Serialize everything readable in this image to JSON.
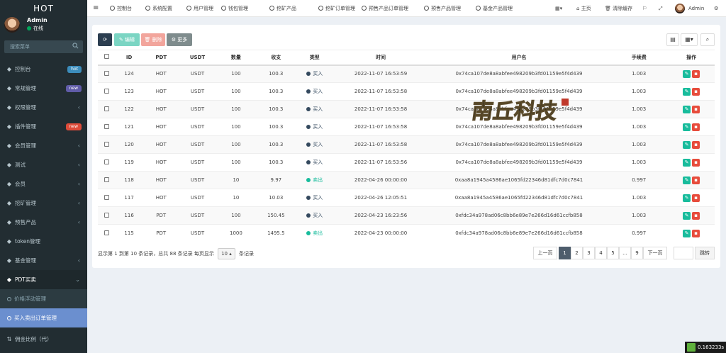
{
  "sidebar": {
    "logo": "HOT",
    "user": {
      "name": "Admin",
      "status": "在线"
    },
    "search_placeholder": "搜索菜单",
    "items": [
      {
        "icon": "dashboard-icon",
        "label": "控制台",
        "badge": "hot"
      },
      {
        "icon": "settings-icon",
        "label": "常规管理",
        "badge": "new"
      },
      {
        "icon": "group-icon",
        "label": "权限管理",
        "arrow": "‹"
      },
      {
        "icon": "plugin-icon",
        "label": "插件管理",
        "badge": "new"
      },
      {
        "icon": "user-group-icon",
        "label": "会员管理",
        "arrow": "‹"
      },
      {
        "icon": "file-icon",
        "label": "测试",
        "arrow": "‹"
      },
      {
        "icon": "user-icon",
        "label": "会员",
        "arrow": "‹"
      },
      {
        "icon": "mining-icon",
        "label": "挖矿管理",
        "arrow": "‹"
      },
      {
        "icon": "presale-icon",
        "label": "预售产品",
        "arrow": "‹"
      },
      {
        "icon": "token-icon",
        "label": "token管理"
      },
      {
        "icon": "fund-icon",
        "label": "基金管理",
        "arrow": "‹"
      },
      {
        "icon": "pdt-trade-icon",
        "label": "PDT买卖",
        "arrow": "⌄"
      }
    ],
    "sub_items": [
      {
        "label": "价格浮动管理"
      },
      {
        "label": "买入卖出订单管理"
      }
    ],
    "bottom_item": {
      "label": "佣金比例（代）"
    }
  },
  "topbar": {
    "tabs": [
      "控制台",
      "系统配置",
      "用户管理",
      "钱包管理",
      "挖矿产品",
      "挖矿订单管理",
      "预售产品订单管理",
      "预售产品管理",
      "基金产品管理"
    ],
    "home": "主页",
    "clear_cache": "清除缓存",
    "admin": "Admin"
  },
  "toolbar": {
    "edit": "编辑",
    "delete": "删除",
    "more": "更多"
  },
  "table": {
    "headers": [
      "ID",
      "PDT",
      "USDT",
      "数量",
      "收支",
      "类型",
      "时间",
      "用户名",
      "手续费",
      "操作"
    ],
    "rows": [
      {
        "id": "124",
        "pdt": "HOT",
        "usdt": "USDT",
        "qty": "100",
        "amount": "100.3",
        "type": "买入",
        "time": "2022-11-07 16:53:59",
        "user": "0x74ca107de8a8abfee498209b3fd01159e5f4d439",
        "fee": "1.003"
      },
      {
        "id": "123",
        "pdt": "HOT",
        "usdt": "USDT",
        "qty": "100",
        "amount": "100.3",
        "type": "买入",
        "time": "2022-11-07 16:53:58",
        "user": "0x74ca107de8a8abfee498209b3fd01159e5f4d439",
        "fee": "1.003"
      },
      {
        "id": "122",
        "pdt": "HOT",
        "usdt": "USDT",
        "qty": "100",
        "amount": "100.3",
        "type": "买入",
        "time": "2022-11-07 16:53:58",
        "user": "0x74ca107de8a8abfee498209b3fd01159e5f4d439",
        "fee": "1.003"
      },
      {
        "id": "121",
        "pdt": "HOT",
        "usdt": "USDT",
        "qty": "100",
        "amount": "100.3",
        "type": "买入",
        "time": "2022-11-07 16:53:58",
        "user": "0x74ca107de8a8abfee498209b3fd01159e5f4d439",
        "fee": "1.003"
      },
      {
        "id": "120",
        "pdt": "HOT",
        "usdt": "USDT",
        "qty": "100",
        "amount": "100.3",
        "type": "买入",
        "time": "2022-11-07 16:53:58",
        "user": "0x74ca107de8a8abfee498209b3fd01159e5f4d439",
        "fee": "1.003"
      },
      {
        "id": "119",
        "pdt": "HOT",
        "usdt": "USDT",
        "qty": "100",
        "amount": "100.3",
        "type": "买入",
        "time": "2022-11-07 16:53:56",
        "user": "0x74ca107de8a8abfee498209b3fd01159e5f4d439",
        "fee": "1.003"
      },
      {
        "id": "118",
        "pdt": "HOT",
        "usdt": "USDT",
        "qty": "10",
        "amount": "9.97",
        "type": "卖出",
        "time": "2022-04-26 00:00:00",
        "user": "0xaa8a1945a4586ae1065fd22346d81dfc7d0c7841",
        "fee": "0.997"
      },
      {
        "id": "117",
        "pdt": "HOT",
        "usdt": "USDT",
        "qty": "10",
        "amount": "10.03",
        "type": "买入",
        "time": "2022-04-26 12:05:51",
        "user": "0xaa8a1945a4586ae1065fd22346d81dfc7d0c7841",
        "fee": "1.003"
      },
      {
        "id": "116",
        "pdt": "PDT",
        "usdt": "USDT",
        "qty": "100",
        "amount": "150.45",
        "type": "买入",
        "time": "2022-04-23 16:23:56",
        "user": "0xfdc34a978ad06c8bb6e89e7e266d16d61ccfb858",
        "fee": "1.003"
      },
      {
        "id": "115",
        "pdt": "PDT",
        "usdt": "USDT",
        "qty": "1000",
        "amount": "1495.5",
        "type": "卖出",
        "time": "2022-04-23 00:00:00",
        "user": "0xfdc34a978ad06c8bb6e89e7e266d16d61ccfb858",
        "fee": "0.997"
      }
    ]
  },
  "colors": {
    "buy": "#34495e",
    "sell": "#18bc9c"
  },
  "footer": {
    "summary": "显示第 1 到第 10 条记录，总共 88 条记录 每页显示",
    "page_size": "10",
    "suffix": "条记录"
  },
  "pagination": {
    "prev": "上一页",
    "pages": [
      "1",
      "2",
      "3",
      "4",
      "5",
      "...",
      "9"
    ],
    "next": "下一页",
    "jump": "跳转"
  },
  "watermark": "南丘科技",
  "timer": "0.163233s"
}
